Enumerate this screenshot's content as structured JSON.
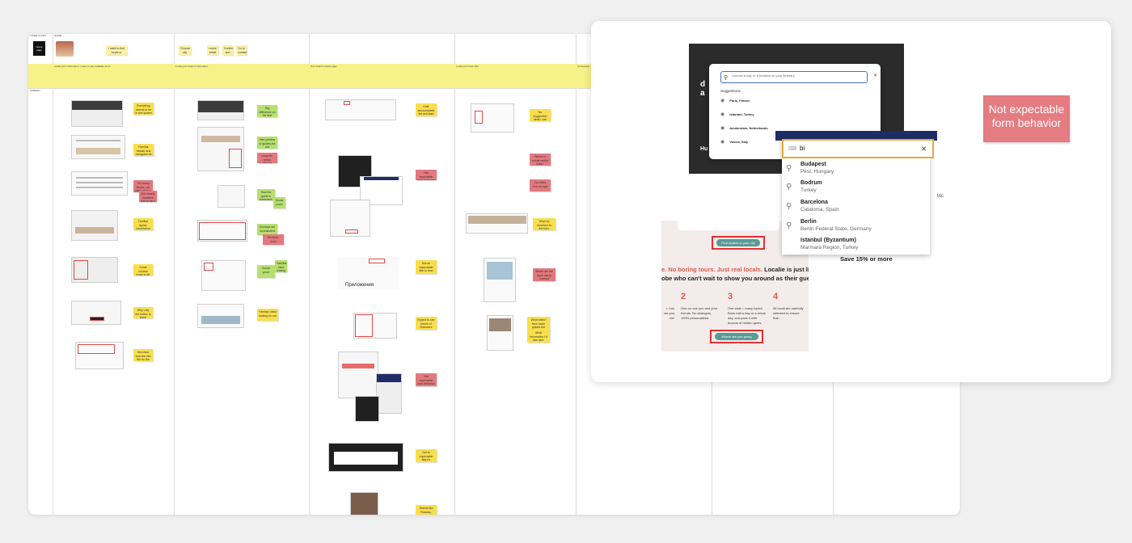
{
  "board": {
    "header_labels": [
      "USER STORY",
      "HOME",
      "",
      "",
      "",
      ""
    ],
    "logo_text": "Home page",
    "top_sticky": "I want to find locals in Amsterdam",
    "search_stickies": [
      "Choose city",
      "Leave email",
      "Confirm and pay",
      "Go to contact"
    ],
    "stage_texts": [
      "Looking for information, I want to see available tours",
      "Looking for search information",
      "Tour search results page",
      "Looking for best offer",
      "Conversion"
    ],
    "row_label": "SCREEN",
    "stickies_col1": [
      "Everything seems to be in one screen",
      "Familiar header and navigation at the top",
      "Too many blocks, not clear what to do",
      "Not clearly readable text at hero",
      "Familiar layout, information is easy to find",
      "Some unclear icons to be selected",
      "Why only the button is black",
      "Not clear how the info fits for the intent"
    ],
    "stickies_col2": [
      "Big difference on the first screen",
      "Hero photos of guides are not consistent",
      "Long list, needs filtering",
      "How the guide is presented, that can be used",
      "Social proof",
      "Overlays are inconsistent",
      "Reviews, nice!",
      "Social proof",
      "Familiar, ideal looking for me"
    ],
    "stickies_col3": [
      "Hide autocomplete list and start with data",
      "Not expectable form behavior",
      "Not an expectable title to land",
      "Expect to see prices of reviewers",
      "Not to expectable flag for Russian",
      "Seems like Russian, wrong!"
    ],
    "stickies_col4": [
      "No suggestion what I can find before",
      "Where is social media links?",
      "Too likely from an app",
      "Why not Vouchers to the hero recommendation",
      "Where are the block use in \"Contact\" button",
      "What extra? How much guests the field?",
      "What information I'd like here"
    ],
    "lang_label": "Приложения"
  },
  "panel": {
    "search_modal": {
      "placeholder": "Choose a city, or a location on your itinerary",
      "suggestions_label": "Suggestions",
      "suggestions": [
        "Paris, France",
        "Istanbul, Turkey",
        "Amsterdam, Netherlands",
        "Venice, Italy"
      ]
    },
    "dropdown": {
      "typed": "bi",
      "results": [
        {
          "title": "Budapest",
          "subtitle": "Pest, Hungary"
        },
        {
          "title": "Bodrum",
          "subtitle": "Turkey"
        },
        {
          "title": "Barcelona",
          "subtitle": "Catalonia, Spain"
        },
        {
          "title": "Berlin",
          "subtitle": "Berlin Federal State, Germany"
        },
        {
          "title": "Istanbul (Byzantium)",
          "subtitle": "Marmara Region, Turkey"
        }
      ]
    },
    "site": {
      "find_button": "Find locales in your city",
      "tagline_red": "e. No boring tours. Just real locals.",
      "tagline_bold": " Localie is just like vi",
      "tagline2": "obe who can't wait to show you around as their guest.",
      "steps": [
        {
          "num": "2",
          "text": "One on one you and your friends. No strangers. 100% personalized."
        },
        {
          "num": "3",
          "text": "One walk = many topics. Book half a day or a whole day, and pack it with dozens of hidden gems."
        },
        {
          "num": "4",
          "text": "All locali are carefully selected to ensure that..."
        }
      ],
      "step1_text": "r, bus ver you rter",
      "going_button": "Where are you going to?",
      "side_save": "Save 15% or more",
      "side_tric": "tric",
      "hero_initial": "d a",
      "hero_bottom": "Hu"
    },
    "note": "Not expectable form behavior"
  }
}
